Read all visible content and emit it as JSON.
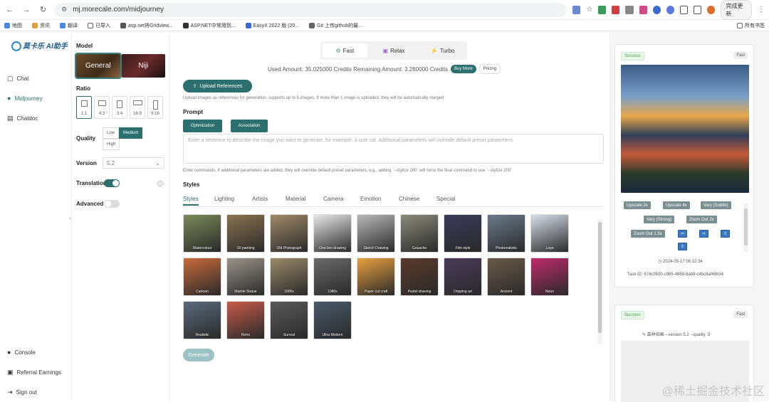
{
  "browser": {
    "url": "mj.morecale.com/midjourney",
    "update_label": "完成更新"
  },
  "bookmarks": [
    "地图",
    "资讯",
    "翻译",
    "已导入",
    "asp.net将Gridview...",
    "ASP.NET中常用到...",
    "EasyX 2022 版 (20...",
    "Git 上传github的最..."
  ],
  "bookmarks_right": "所有书签",
  "leftnav": {
    "logo": "莫卡乐 AI助手",
    "items": [
      {
        "label": "Chat",
        "icon": "chat-bubble-icon"
      },
      {
        "label": "Midjourney",
        "icon": "compass-icon"
      },
      {
        "label": "Chatdoc",
        "icon": "document-icon"
      }
    ],
    "bottom": [
      {
        "label": "Console",
        "icon": "console-icon"
      },
      {
        "label": "Referral Earnings",
        "icon": "gift-icon"
      },
      {
        "label": "Sign out",
        "icon": "sign-out-icon"
      }
    ]
  },
  "settings": {
    "model_label": "Model",
    "models": [
      "General",
      "Niji"
    ],
    "ratio_label": "Ratio",
    "ratios": [
      "1:1",
      "4:3",
      "3:4",
      "16:9",
      "9:16"
    ],
    "quality_label": "Quality",
    "qualities": [
      "Low",
      "Medium",
      "High"
    ],
    "version_label": "Version",
    "version_value": "5.2",
    "translation_label": "Translation",
    "advanced_label": "Advanced"
  },
  "main": {
    "modes": [
      "Fast",
      "Relax",
      "Turbo"
    ],
    "usage_text": "Used Amount: 35.025000 Credits Remaining Amount: 3.260000 Credits",
    "buy_more": "Buy More",
    "pricing": "Pricing",
    "upload_label": "Upload References",
    "upload_hint": "Upload images as references for generation, supports up to 5 images. If more than 1 image is uploaded, they will be automatically merged",
    "prompt_label": "Prompt",
    "optimization": "Optimization",
    "association": "Association",
    "prompt_placeholder": "Enter a sentence to describe the image you want to generate, for example: a cute cat. Additional parameters will override default preset parameters",
    "command_hint": "Enter commands, if additional parameters are added, they will override default preset parameters, e.g., adding `--stylize 200` will force the final command to use `--stylize 200`",
    "styles_label": "Styles",
    "style_tabs": [
      "Styles",
      "Lighting",
      "Artists",
      "Material",
      "Camera",
      "Emotion",
      "Chinese",
      "Special"
    ],
    "style_tiles": [
      {
        "label": "Watercolour",
        "color": "#7a8a5a"
      },
      {
        "label": "Oil painting",
        "color": "#8a7250"
      },
      {
        "label": "Old Photograph",
        "color": "#a08a6a"
      },
      {
        "label": "One-line drawing",
        "color": "#e8e8e8"
      },
      {
        "label": "Sketch Drawing",
        "color": "#b8b8b8"
      },
      {
        "label": "Gouache",
        "color": "#8a8a7a"
      },
      {
        "label": "Film style",
        "color": "#3a3a5a"
      },
      {
        "label": "Photorealistic",
        "color": "#6a7a8a"
      },
      {
        "label": "Logo",
        "color": "#d8e0ea"
      },
      {
        "label": "Cartoon",
        "color": "#c86a3a"
      },
      {
        "label": "Marble Statue",
        "color": "#9a948a"
      },
      {
        "label": "1800s",
        "color": "#9a8a6a"
      },
      {
        "label": "1980s",
        "color": "#6a6a6a"
      },
      {
        "label": "Paper cut craft",
        "color": "#e8a040"
      },
      {
        "label": "Pastel drawing",
        "color": "#5a3a2a"
      },
      {
        "label": "Dripping art",
        "color": "#4a3a5a"
      },
      {
        "label": "Ancient",
        "color": "#6a5a4a"
      },
      {
        "label": "Neon",
        "color": "#c02a6a"
      },
      {
        "label": "Realistic",
        "color": "#5a6a7a"
      },
      {
        "label": "Retro",
        "color": "#c85a4a"
      },
      {
        "label": "Surreal",
        "color": "#5a5a5a"
      },
      {
        "label": "Ultra Modern",
        "color": "#4a5a6a"
      }
    ],
    "generate": "Generate"
  },
  "results": [
    {
      "status": "Success",
      "speed": "Fast",
      "actions": [
        "Upscale 2x",
        "Upscale 4x",
        "Vary (Subtle)",
        "Vary (Strong)",
        "Zoom Out 2x",
        "Zoom Out 1.5x"
      ],
      "timestamp": "2024-05-17 06:12:34",
      "task_id": "Task ID: 674c0500-c965-4868-8ab9-c4bc8af46b34"
    },
    {
      "status": "Success",
      "speed": "Fast",
      "prompt": "森林如画 --version 5.2 --quality .5"
    }
  ],
  "watermark": "@稀土掘金技术社区",
  "colors": {
    "accent": "#2b6f6f",
    "success": "#4aa04a"
  }
}
